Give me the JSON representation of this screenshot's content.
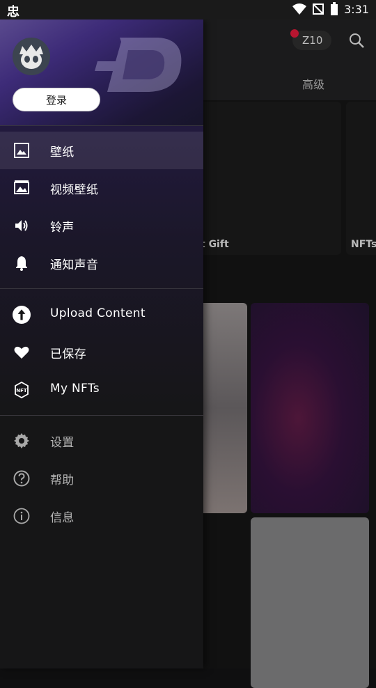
{
  "status_bar": {
    "left_icon": "忠",
    "time": "3:31"
  },
  "background": {
    "coin_count": "Z10",
    "tab_advanced": "高级",
    "card_label_1": "t Gift",
    "card_label_2": "NFTs"
  },
  "drawer": {
    "login_label": "登录",
    "items_top": [
      {
        "label": "壁纸",
        "icon": "image-icon",
        "selected": true
      },
      {
        "label": "视频壁纸",
        "icon": "video-wallpaper-icon"
      },
      {
        "label": "铃声",
        "icon": "speaker-icon"
      },
      {
        "label": "通知声音",
        "icon": "bell-icon"
      }
    ],
    "items_mid": [
      {
        "label": "Upload Content",
        "icon": "upload-icon"
      },
      {
        "label": "已保存",
        "icon": "heart-icon"
      },
      {
        "label": "My NFTs",
        "icon": "nft-icon"
      }
    ],
    "items_bottom": [
      {
        "label": "设置",
        "icon": "gear-icon"
      },
      {
        "label": "帮助",
        "icon": "help-icon"
      },
      {
        "label": "信息",
        "icon": "info-icon"
      }
    ]
  }
}
